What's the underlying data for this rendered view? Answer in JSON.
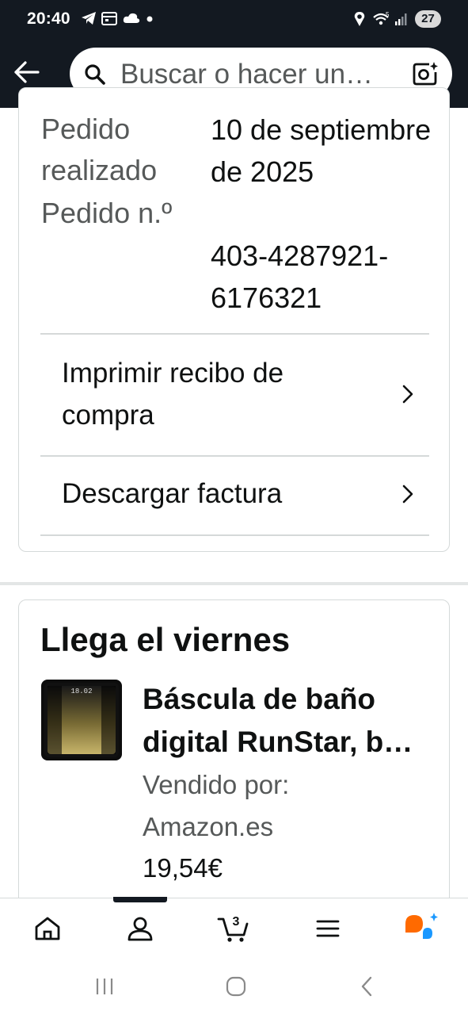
{
  "status_bar": {
    "time": "20:40",
    "icons": [
      "telegram-icon",
      "calendar-icon",
      "cloud-icon",
      "dot-icon",
      "location-icon",
      "wifi-icon",
      "signal-icon"
    ],
    "battery": "27"
  },
  "header": {
    "search_placeholder": "Buscar o hacer un…",
    "icons": [
      "back-arrow-icon",
      "search-icon",
      "camera-icon"
    ]
  },
  "order": {
    "placed_label": "Pedido realizado",
    "placed_value": "10 de septiembre de 2025",
    "number_label": "Pedido n.º",
    "number_value": "403-4287921-6176321",
    "actions": [
      {
        "label": "Imprimir recibo de compra"
      },
      {
        "label": "Descargar factura"
      }
    ]
  },
  "delivery": {
    "title": "Llega el viernes",
    "product_name": "Báscula de baño digital RunStar, b…",
    "sold_by_label": "Vendido por:",
    "seller": "Amazon.es",
    "price": "19,54€",
    "thumb_display": "18.02"
  },
  "bottom_nav": {
    "items": [
      "home-icon",
      "account-icon",
      "cart-icon",
      "menu-icon",
      "rufus-icon"
    ],
    "cart_count": "3",
    "active": "account-icon"
  },
  "android_nav": [
    "recents-button",
    "home-button",
    "back-button"
  ],
  "colors": {
    "header_bg": "#131921",
    "text": "#0f1111",
    "secondary_text": "#565959",
    "rufus_orange": "#ff6a00",
    "rufus_blue": "#1a98ff"
  }
}
